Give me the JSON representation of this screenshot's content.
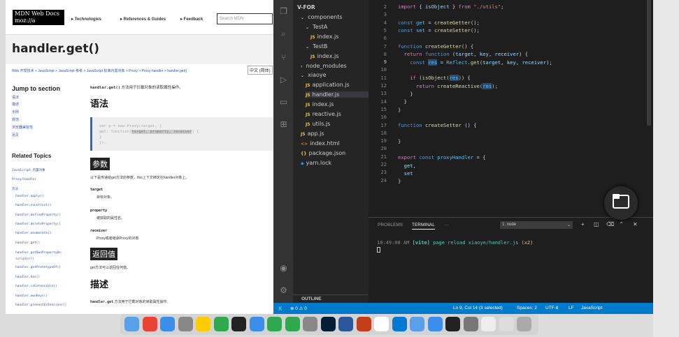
{
  "mdn": {
    "logo_line1": "MDN Web Docs",
    "logo_line2": "moz://a",
    "nav": [
      "▸ Technologies",
      "▸ References & Guides",
      "▸ Feedback"
    ],
    "search_placeholder": "Search MDN",
    "title": "handler.get()",
    "breadcrumb": "Web 开发技术 > JavaScript > JavaScript 参考 > JavaScript 标准内置对象 > Proxy > Proxy handler > handler.get()",
    "language": "中文 (简体)",
    "jump_heading": "Jump to section",
    "jump_items": [
      "语法",
      "描述",
      "示例",
      "规范",
      "浏览器兼容性",
      "另见"
    ],
    "related_heading": "Related Topics",
    "related_items": [
      "JavaScript 内置对象",
      "Proxy/handler",
      "方法",
      "handler.apply()",
      "handler.construct()",
      "handler.defineProperty()",
      "handler.deleteProperty()",
      "handler.enumerate()",
      "handler.get()",
      "handler.getOwnPropertyDe-",
      "scriptor()",
      "handler.getPrototypeOf()",
      "handler.has()",
      "handler.isExtensible()",
      "handler.ownKeys()",
      "handler.preventExtensions()"
    ],
    "intro_code": "handler.get()",
    "intro_text": " 方法用于拦截对象的读取属性操作。",
    "h_syntax": "语法",
    "code_line1": "var p = new Proxy(target, {",
    "code_line2_pre": "  get: function(",
    "code_line2_hl": "target, property, receiver",
    "code_line2_post": ") {",
    "code_line3": "  }",
    "code_line4": "});",
    "h_params": "参数",
    "params_intro": "以下是传递给get方法的参数，this上下文绑定在handler对象上。",
    "params": [
      {
        "term": "target",
        "desc": "目标对象。"
      },
      {
        "term": "property",
        "desc": "被获取的属性名。"
      },
      {
        "term": "receiver",
        "desc": "Proxy或者继承Proxy的对象"
      }
    ],
    "h_return": "返回值",
    "return_text": "get方法可以返回任何值。",
    "h_desc": "描述",
    "desc_code": "handler.get",
    "desc_text": " 方法用于拦截对象的读取属性操作。"
  },
  "vscode": {
    "explorer_root": "V-FOR",
    "tree": [
      {
        "label": "components",
        "kind": "folder-open",
        "depth": 1
      },
      {
        "label": "TestA",
        "kind": "folder-open",
        "depth": 2
      },
      {
        "label": "index.js",
        "kind": "js",
        "depth": 3
      },
      {
        "label": "TestB",
        "kind": "folder-open",
        "depth": 2
      },
      {
        "label": "index.js",
        "kind": "js",
        "depth": 3
      },
      {
        "label": "node_modules",
        "kind": "folder",
        "depth": 1
      },
      {
        "label": "xiaoye",
        "kind": "folder-open",
        "depth": 1
      },
      {
        "label": "application.js",
        "kind": "js",
        "depth": 2
      },
      {
        "label": "handler.js",
        "kind": "js",
        "depth": 2
      },
      {
        "label": "index.js",
        "kind": "js",
        "depth": 2
      },
      {
        "label": "reactive.js",
        "kind": "js",
        "depth": 2
      },
      {
        "label": "utils.js",
        "kind": "js",
        "depth": 2
      },
      {
        "label": "app.js",
        "kind": "js",
        "depth": 1
      },
      {
        "label": "index.html",
        "kind": "html",
        "depth": 1
      },
      {
        "label": "package.json",
        "kind": "json",
        "depth": 1
      },
      {
        "label": "yarn.lock",
        "kind": "lock",
        "depth": 1
      }
    ],
    "outline_label": "OUTLINE",
    "code_lines": [
      "2",
      "3",
      "4",
      "5",
      "6",
      "7",
      "8",
      "9",
      "10",
      "11",
      "12",
      "13",
      "14",
      "15",
      "16",
      "17",
      "18",
      "19",
      "20",
      "21",
      "22",
      "23",
      "24"
    ],
    "panel_tabs": [
      "PROBLEMS",
      "TERMINAL",
      "···"
    ],
    "terminal_select": "1: node",
    "terminal_time": "10:49:08 AM",
    "terminal_tag": "[vite]",
    "terminal_msg": " page reload xiaoye/handler.js ",
    "terminal_count": "(x2)",
    "status": {
      "problems": "⊗ 0 ⚠ 0",
      "position": "Ln 9, Col 14 (3 selected)",
      "spaces": "Spaces: 2",
      "encoding": "UTF-8",
      "eol": "LF",
      "language": "JavaScript"
    }
  },
  "colors": {
    "vscode_status": "#007acc",
    "vscode_bg": "#1e1e1e",
    "mdn_link": "#3355aa"
  },
  "dock_icons": [
    "finder-icon",
    "chrome-icon",
    "safari-icon",
    "app-icon",
    "app-icon",
    "h-icon",
    "qq-icon",
    "app-icon",
    "wechat-icon",
    "app-icon",
    "app-icon",
    "ps-icon",
    "word-icon",
    "powerpoint-icon",
    "calendar-icon",
    "vscode-icon",
    "app-icon",
    "app-icon",
    "terminal-icon",
    "settings-icon",
    "app-icon",
    "app-icon",
    "trash-icon"
  ]
}
